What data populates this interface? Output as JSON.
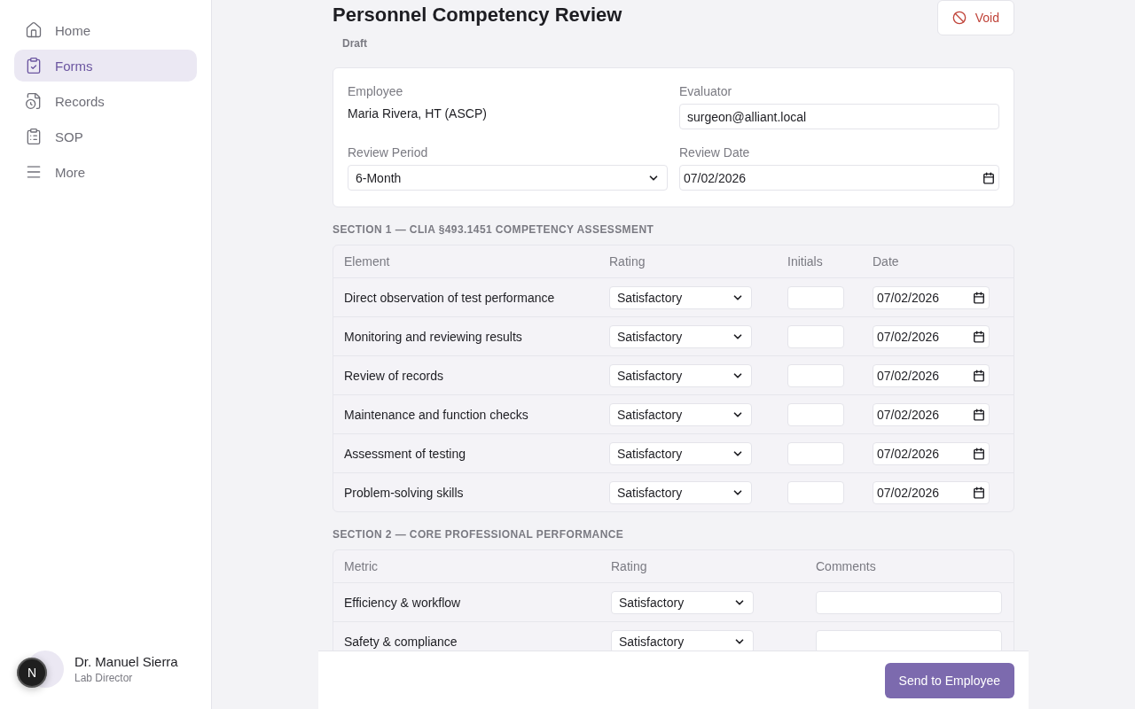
{
  "sidebar": {
    "items": [
      {
        "label": "Home",
        "selected": false
      },
      {
        "label": "Forms",
        "selected": true
      },
      {
        "label": "Records",
        "selected": false
      },
      {
        "label": "SOP",
        "selected": false
      },
      {
        "label": "More",
        "selected": false
      }
    ],
    "user": {
      "name": "Dr. Manuel Sierra",
      "role": "Lab Director"
    },
    "dev_badge": "N"
  },
  "header": {
    "title": "Personnel Competency Review",
    "status": "Draft",
    "void_button": "Void"
  },
  "details": [
    {
      "label": "Employee",
      "kind": "text",
      "value": "Maria Rivera, HT (ASCP)"
    },
    {
      "label": "Evaluator",
      "kind": "input",
      "value": "surgeon@alliant.local"
    },
    {
      "label": "Review Period",
      "kind": "select",
      "value": "6-Month"
    },
    {
      "label": "Review Date",
      "kind": "date",
      "value": "07/02/2026"
    }
  ],
  "section_1": {
    "title": "SECTION 1 — CLIA §493.1451 COMPETENCY ASSESSMENT",
    "columns": [
      "Element",
      "Rating",
      "Initials",
      "Date"
    ],
    "rows": [
      {
        "element": "Direct observation of test performance",
        "rating": "Satisfactory",
        "date": "07/02/2026"
      },
      {
        "element": "Monitoring and reviewing results",
        "rating": "Satisfactory",
        "date": "07/02/2026"
      },
      {
        "element": "Review of records",
        "rating": "Satisfactory",
        "date": "07/02/2026"
      },
      {
        "element": "Maintenance and function checks",
        "rating": "Satisfactory",
        "date": "07/02/2026"
      },
      {
        "element": "Assessment of testing",
        "rating": "Satisfactory",
        "date": "07/02/2026"
      },
      {
        "element": "Problem-solving skills",
        "rating": "Satisfactory",
        "date": "07/02/2026"
      }
    ]
  },
  "section_2": {
    "title": "SECTION 2 — CORE PROFESSIONAL PERFORMANCE",
    "columns": [
      "Metric",
      "Rating",
      "Comments"
    ],
    "rows": [
      {
        "metric": "Efficiency & workflow",
        "rating": "Satisfactory"
      },
      {
        "metric": "Safety & compliance",
        "rating": "Satisfactory"
      }
    ]
  },
  "footer": {
    "primary_button": "Send to Employee"
  }
}
